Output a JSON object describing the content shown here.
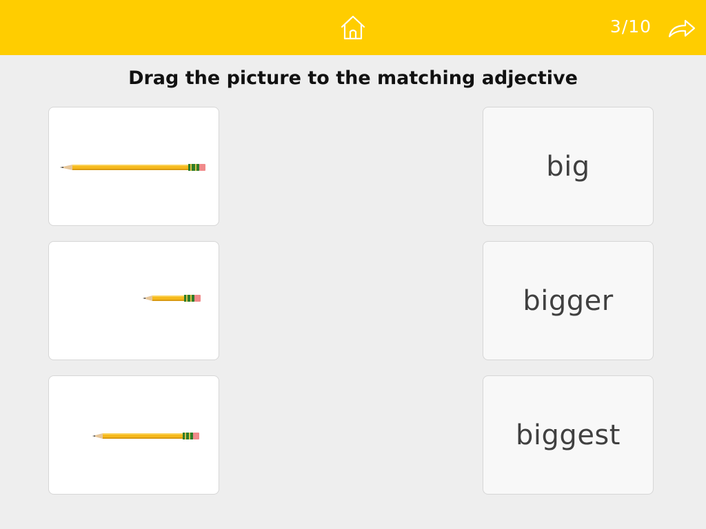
{
  "header": {
    "home_icon": "home-icon",
    "progress": "3/10",
    "next_icon": "forward-arrow-icon"
  },
  "instruction": "Drag the picture to the matching adjective",
  "pictures": [
    {
      "depicts": "pencil-long",
      "icon": "pencil-icon"
    },
    {
      "depicts": "pencil-short",
      "icon": "pencil-icon"
    },
    {
      "depicts": "pencil-medium",
      "icon": "pencil-icon"
    }
  ],
  "adjectives": [
    "big",
    "bigger",
    "biggest"
  ],
  "colors": {
    "header": "#ffcd00",
    "background": "#eeeeee",
    "pencil": "#f6b91c",
    "pencil_band": "#2f7d2a",
    "eraser": "#f08a8a"
  }
}
